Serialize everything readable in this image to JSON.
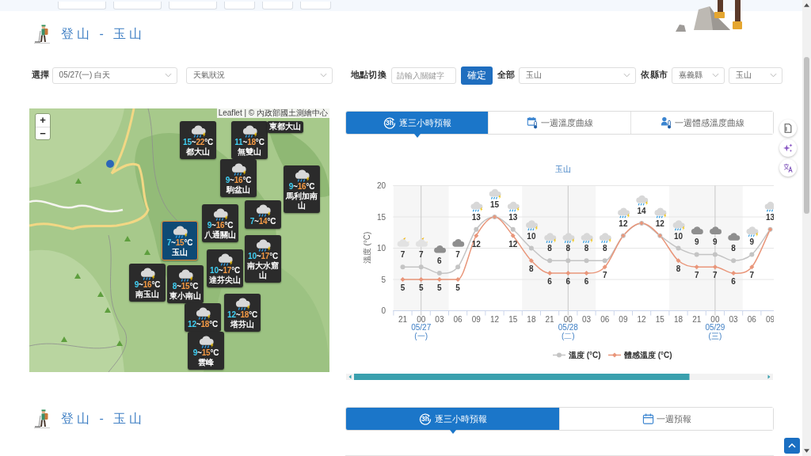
{
  "header": {
    "title": "登山 - 玉山"
  },
  "filters": {
    "select_label": "選擇",
    "date_select": {
      "value": "05/27(一) 白天"
    },
    "element_select": {
      "value": "天氣狀況"
    },
    "location_label": "地點切換",
    "keyword_field": {
      "placeholder": "請輸入關鍵字"
    },
    "confirm_button": "確定",
    "all_label": "全部",
    "all_select": {
      "value": "玉山"
    },
    "county_label": "依縣市",
    "county_select": {
      "value": "嘉義縣"
    },
    "site_select": {
      "value": "玉山"
    }
  },
  "map": {
    "zoom_in": "+",
    "zoom_out": "−",
    "attribution": "Leaflet | © 內政部國土測繪中心",
    "markers": [
      {
        "kind": "tile",
        "name": "都大山",
        "low": "15",
        "sep": "~",
        "high": "22",
        "unit": "°C",
        "selected": false
      },
      {
        "kind": "tile",
        "name": "無雙山",
        "low": "11",
        "sep": "~",
        "high": "18",
        "unit": "°C",
        "selected": false
      },
      {
        "kind": "label",
        "name": "東都大山",
        "selected": false
      },
      {
        "kind": "tile",
        "name": "駒盆山",
        "low": "9",
        "sep": "~",
        "high": "16",
        "unit": "°C",
        "selected": false
      },
      {
        "kind": "tile",
        "name": "馬利加南山",
        "low": "9",
        "sep": "~",
        "high": "16",
        "unit": "°C",
        "selected": false
      },
      {
        "kind": "tile",
        "name": "八通關山",
        "low": "9",
        "sep": "~",
        "high": "16",
        "unit": "°C",
        "selected": false
      },
      {
        "kind": "temp-only",
        "low": "7",
        "sep": "~",
        "high": "14",
        "unit": "°C",
        "selected": false
      },
      {
        "kind": "tile",
        "name": "玉山",
        "low": "7",
        "sep": "~",
        "high": "15",
        "unit": "°C",
        "selected": true
      },
      {
        "kind": "tile",
        "name": "南大水窟山",
        "low": "10",
        "sep": "~",
        "high": "17",
        "unit": "°C",
        "selected": false
      },
      {
        "kind": "tile",
        "name": "達芬尖山",
        "low": "10",
        "sep": "~",
        "high": "17",
        "unit": "°C",
        "selected": false
      },
      {
        "kind": "tile",
        "name": "南玉山",
        "low": "9",
        "sep": "~",
        "high": "16",
        "unit": "°C",
        "selected": false
      },
      {
        "kind": "tile",
        "name": "東小南山",
        "low": "8",
        "sep": "~",
        "high": "15",
        "unit": "°C",
        "selected": false
      },
      {
        "kind": "temp-only",
        "low": "12",
        "sep": "~",
        "high": "18",
        "unit": "°C",
        "selected": false
      },
      {
        "kind": "tile",
        "name": "塔芬山",
        "low": "12",
        "sep": "~",
        "high": "18",
        "unit": "°C",
        "selected": false
      },
      {
        "kind": "tile",
        "name": "雲峰",
        "low": "9",
        "sep": "~",
        "high": "15",
        "unit": "°C",
        "selected": false
      }
    ]
  },
  "forecast": {
    "tabs": [
      {
        "kind": "three-hour",
        "badge": "3h",
        "label": "逐三小時預報",
        "selected": true
      },
      {
        "kind": "calendar-thermometer",
        "label": "一週溫度曲線",
        "selected": false
      },
      {
        "kind": "person-thermometer",
        "label": "一週體感溫度曲線",
        "selected": false
      }
    ],
    "chart_data": {
      "type": "line",
      "title": "玉山",
      "ylabel": "溫度 (°C)",
      "categories": [
        "21",
        "00",
        "03",
        "06",
        "09",
        "12",
        "15",
        "18",
        "21",
        "00",
        "03",
        "06",
        "09",
        "12",
        "15",
        "18",
        "21",
        "00",
        "03",
        "06",
        "09"
      ],
      "series": [
        {
          "name": "溫度 (°C)",
          "color": "#c4c4c4",
          "marker": "circle",
          "values": [
            7,
            7,
            6,
            7,
            13,
            15,
            13,
            10,
            8,
            8,
            8,
            8,
            12,
            14,
            12,
            10,
            9,
            9,
            8,
            9,
            13
          ],
          "value_labels": [
            "7",
            "7",
            "6",
            "7",
            "13",
            "15",
            "13",
            "10",
            "8",
            "8",
            "8",
            "8",
            "12",
            "14",
            "12",
            "10",
            "9",
            "9",
            "8",
            "9",
            "13"
          ]
        },
        {
          "name": "體感溫度 (°C)",
          "color": "#e9967a",
          "marker": "diamond",
          "values": [
            5,
            5,
            5,
            5,
            12,
            15,
            12,
            8,
            6,
            6,
            6,
            7,
            12,
            14,
            12,
            8,
            7,
            7,
            6,
            7,
            13
          ],
          "value_labels": [
            "5",
            "5",
            "5",
            "5",
            "12",
            null,
            "12",
            "8",
            "6",
            "6",
            "6",
            "7",
            null,
            null,
            null,
            "8",
            "7",
            "7",
            "6",
            "7",
            null
          ]
        }
      ],
      "ylim": [
        0,
        20
      ],
      "yticks": [
        0,
        5,
        10,
        15,
        20
      ],
      "grid": true,
      "legend": "bottom"
    },
    "forecast_icons": [
      {
        "kind": "moon-cloud"
      },
      {
        "kind": "moon-cloud"
      },
      {
        "kind": "cloud"
      },
      {
        "kind": "cloud"
      },
      {
        "kind": "rain"
      },
      {
        "kind": "rain"
      },
      {
        "kind": "rain"
      },
      {
        "kind": "rain"
      },
      {
        "kind": "rain"
      },
      {
        "kind": "rain"
      },
      {
        "kind": "rain"
      },
      {
        "kind": "rain"
      },
      {
        "kind": "rain"
      },
      {
        "kind": "rain"
      },
      {
        "kind": "rain"
      },
      {
        "kind": "rain"
      },
      {
        "kind": "cloud"
      },
      {
        "kind": "cloud"
      },
      {
        "kind": "cloud"
      },
      {
        "kind": "rain"
      },
      {
        "kind": "rain"
      }
    ],
    "day_labels": [
      {
        "date": "05/27",
        "weekday": "(一)"
      },
      {
        "date": "05/28",
        "weekday": "(二)"
      },
      {
        "date": "05/29",
        "weekday": "(三)"
      }
    ]
  },
  "second_section": {
    "title": "登山 - 玉山",
    "tabs": [
      {
        "kind": "three-hour",
        "badge": "3h",
        "label": "逐三小時預報",
        "selected": true
      },
      {
        "kind": "calendar",
        "label": "一週預報",
        "selected": false
      }
    ]
  }
}
